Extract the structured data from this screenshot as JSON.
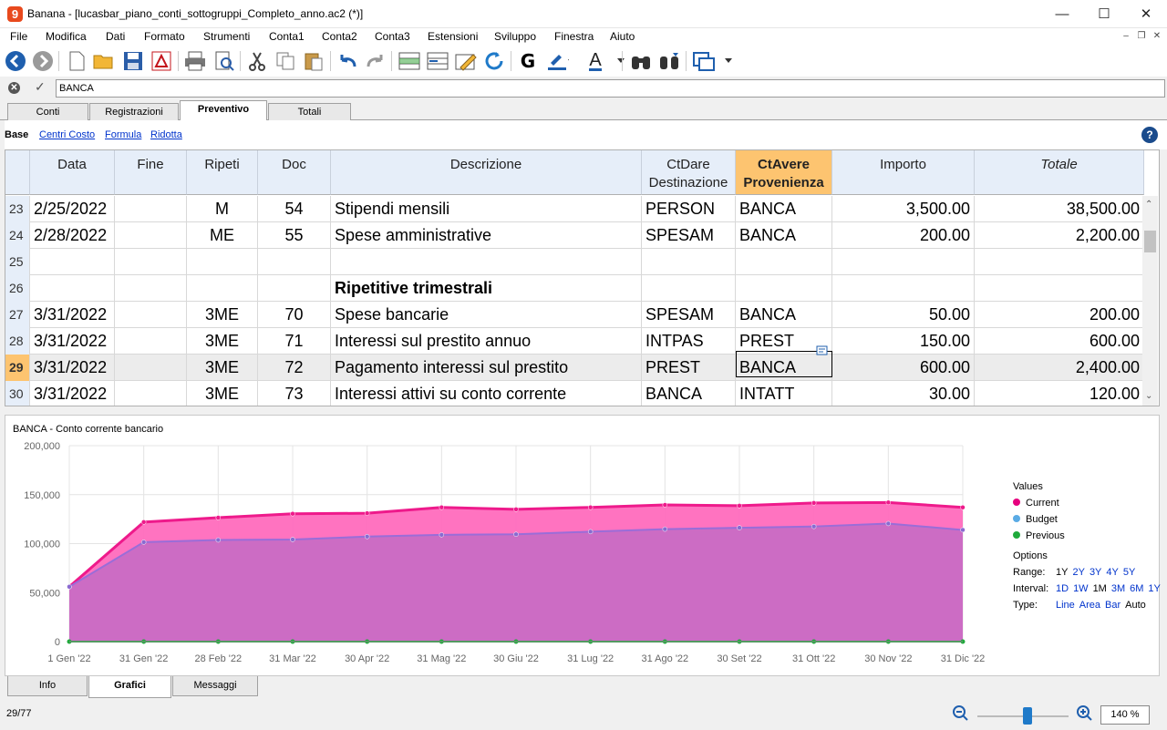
{
  "window": {
    "app_icon": "9",
    "title": "Banana - [lucasbar_piano_conti_sottogruppi_Completo_anno.ac2 (*)]",
    "minimize": "—",
    "maximize": "☐",
    "close": "✕"
  },
  "menu": [
    "File",
    "Modifica",
    "Dati",
    "Formato",
    "Strumenti",
    "Conta1",
    "Conta2",
    "Conta3",
    "Estensioni",
    "Sviluppo",
    "Finestra",
    "Aiuto"
  ],
  "toolbar": {
    "bold": "G",
    "font_color": "A"
  },
  "formula_bar": {
    "value": "BANCA"
  },
  "tabs": [
    "Conti",
    "Registrazioni",
    "Preventivo",
    "Totali"
  ],
  "active_tab": "Preventivo",
  "views": {
    "base": "Base",
    "centri": "Centri Costo",
    "formula": "Formula",
    "ridotta": "Ridotta"
  },
  "help": "?",
  "columns": {
    "data": "Data",
    "fine": "Fine",
    "ripeti": "Ripeti",
    "doc": "Doc",
    "descrizione": "Descrizione",
    "ctdare1": "CtDare",
    "ctdare2": "Destinazione",
    "ctavere1": "CtAvere",
    "ctavere2": "Provenienza",
    "importo": "Importo",
    "totale": "Totale"
  },
  "rows": [
    {
      "n": "23",
      "data": "2/25/2022",
      "fine": "",
      "ripeti": "M",
      "doc": "54",
      "desc": "Stipendi mensili",
      "dare": "PERSON",
      "avere": "BANCA",
      "importo": "3,500.00",
      "totale": "38,500.00"
    },
    {
      "n": "24",
      "data": "2/28/2022",
      "fine": "",
      "ripeti": "ME",
      "doc": "55",
      "desc": "Spese amministrative",
      "dare": "SPESAM",
      "avere": "BANCA",
      "importo": "200.00",
      "totale": "2,200.00"
    },
    {
      "n": "25",
      "data": "",
      "fine": "",
      "ripeti": "",
      "doc": "",
      "desc": "",
      "dare": "",
      "avere": "",
      "importo": "",
      "totale": ""
    },
    {
      "n": "26",
      "data": "",
      "fine": "",
      "ripeti": "",
      "doc": "",
      "desc": "Ripetitive trimestrali",
      "dare": "",
      "avere": "",
      "importo": "",
      "totale": ""
    },
    {
      "n": "27",
      "data": "3/31/2022",
      "fine": "",
      "ripeti": "3ME",
      "doc": "70",
      "desc": "Spese bancarie",
      "dare": "SPESAM",
      "avere": "BANCA",
      "importo": "50.00",
      "totale": "200.00"
    },
    {
      "n": "28",
      "data": "3/31/2022",
      "fine": "",
      "ripeti": "3ME",
      "doc": "71",
      "desc": "Interessi sul prestito annuo",
      "dare": "INTPAS",
      "avere": "PREST",
      "importo": "150.00",
      "totale": "600.00"
    },
    {
      "n": "29",
      "data": "3/31/2022",
      "fine": "",
      "ripeti": "3ME",
      "doc": "72",
      "desc": "Pagamento interessi sul prestito",
      "dare": "PREST",
      "avere": "BANCA",
      "importo": "600.00",
      "totale": "2,400.00"
    },
    {
      "n": "30",
      "data": "3/31/2022",
      "fine": "",
      "ripeti": "3ME",
      "doc": "73",
      "desc": "Interessi attivi su conto corrente",
      "dare": "BANCA",
      "avere": "INTATT",
      "importo": "30.00",
      "totale": "120.00"
    }
  ],
  "current_row": "29",
  "chart_data": {
    "type": "area",
    "title": "BANCA - Conto corrente bancario",
    "x": [
      "1 Gen '22",
      "31 Gen '22",
      "28 Feb '22",
      "31 Mar '22",
      "30 Apr '22",
      "31 Mag '22",
      "30 Giu '22",
      "31 Lug '22",
      "31 Ago '22",
      "30 Set '22",
      "31 Ott '22",
      "30 Nov '22",
      "31 Dic '22"
    ],
    "ylim": [
      0,
      200000
    ],
    "yticks": [
      "0",
      "50,000",
      "100,000",
      "150,000",
      "200,000"
    ],
    "grid": true,
    "legend_position": "right",
    "series": [
      {
        "name": "Current",
        "color": "#e6007e",
        "values": [
          56000,
          122000,
          126500,
          130500,
          131000,
          137000,
          135000,
          137000,
          139500,
          138700,
          141500,
          142000,
          137000
        ]
      },
      {
        "name": "Budget",
        "color": "#5aabe5",
        "values": [
          56000,
          101500,
          103700,
          104200,
          107200,
          109000,
          109500,
          112200,
          114800,
          116200,
          117500,
          120500,
          114000
        ]
      },
      {
        "name": "Previous",
        "color": "#1faa3b",
        "values": [
          0,
          0,
          0,
          0,
          0,
          0,
          0,
          0,
          0,
          0,
          0,
          0,
          0
        ]
      }
    ]
  },
  "chart_panel": {
    "values_title": "Values",
    "options_title": "Options",
    "range_label": "Range:",
    "range": [
      "1Y",
      "2Y",
      "3Y",
      "4Y",
      "5Y"
    ],
    "range_sel": "1Y",
    "interval_label": "Interval:",
    "interval": [
      "1D",
      "1W",
      "1M",
      "3M",
      "6M",
      "1Y"
    ],
    "interval_sel": "1M",
    "type_label": "Type:",
    "types": [
      "Line",
      "Area",
      "Bar",
      "Auto"
    ],
    "type_sel": "Auto"
  },
  "bottom_tabs": [
    "Info",
    "Grafici",
    "Messaggi"
  ],
  "active_bottom_tab": "Grafici",
  "status": {
    "position": "29/77",
    "zoom": "140 %",
    "zoom_level": 0.55
  }
}
